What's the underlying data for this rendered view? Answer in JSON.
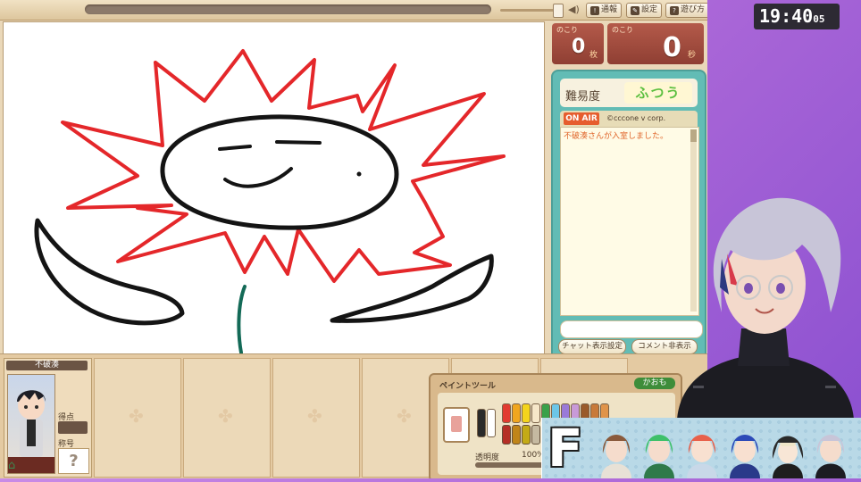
{
  "topbar": {
    "buttons": [
      {
        "label": "通報",
        "icon": "report-icon"
      },
      {
        "label": "設定",
        "icon": "wrench-icon"
      },
      {
        "label": "遊び方",
        "icon": "help-icon"
      }
    ]
  },
  "counters": {
    "cards": {
      "label": "のこり",
      "value": "0",
      "unit": "枚"
    },
    "seconds": {
      "label": "のこり",
      "value": "0",
      "unit": "秒"
    }
  },
  "chat": {
    "difficulty_label": "難易度",
    "difficulty_value": "ふつう",
    "onair_label": "ON AIR",
    "credit": "©cccone v corp.",
    "messages": [
      "不破湊さんが入室しました。"
    ],
    "input_placeholder": "",
    "settings_button": "チャット表示設定",
    "hide_comments_button": "コメント非表示"
  },
  "player": {
    "name": "不破湊",
    "score_label": "得点",
    "title_label": "称号",
    "title_value": "?"
  },
  "paint_tool": {
    "title": "ペイントツール",
    "name_button": "かおも",
    "opacity_label": "透明度",
    "opacity_value": "100%",
    "colors": [
      "#2a2a2a",
      "#ffffff",
      "#e23b30",
      "#f0a61f",
      "#f4d41c",
      "#f6e7c9",
      "#3aa14a",
      "#6cc6e8",
      "#9a7ad8",
      "#c89ad8",
      "#9a5a2a",
      "#c87a3a",
      "#e0944a"
    ]
  },
  "clock": {
    "time": "19:40",
    "seconds": "05"
  },
  "team_banner": {
    "letter": "F"
  }
}
